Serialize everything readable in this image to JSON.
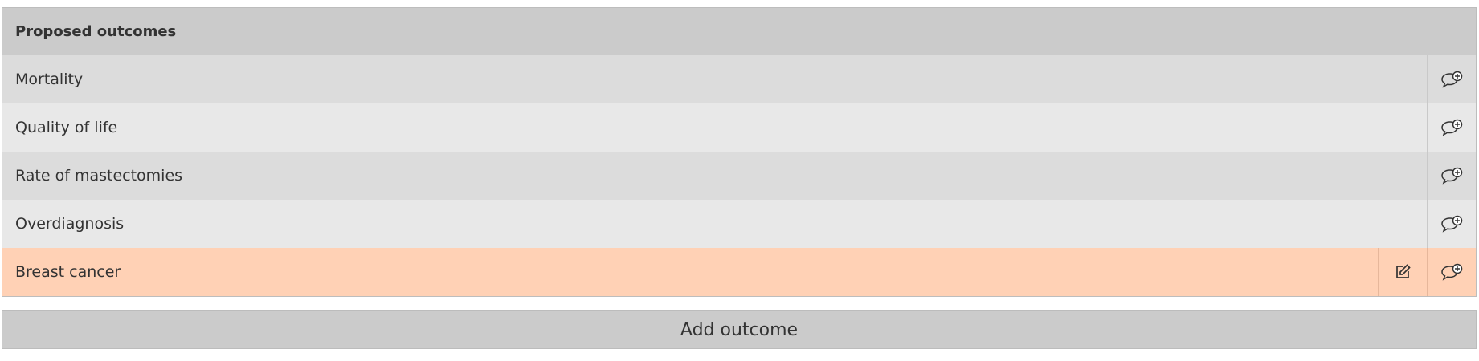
{
  "panel": {
    "title": "Proposed outcomes",
    "rows": [
      {
        "label": "Mortality"
      },
      {
        "label": "Quality of life"
      },
      {
        "label": "Rate of mastectomies"
      },
      {
        "label": "Overdiagnosis"
      },
      {
        "label": "Breast cancer"
      }
    ]
  },
  "add_button_label": "Add outcome",
  "icons": {
    "comment_add": "comment-add-icon",
    "edit": "edit-icon"
  },
  "colors": {
    "header_bg": "#cbcbcb",
    "row_odd_bg": "#dcdcdc",
    "row_even_bg": "#e8e8e8",
    "row_highlight_bg": "#ffd1b5",
    "text": "#333333"
  }
}
